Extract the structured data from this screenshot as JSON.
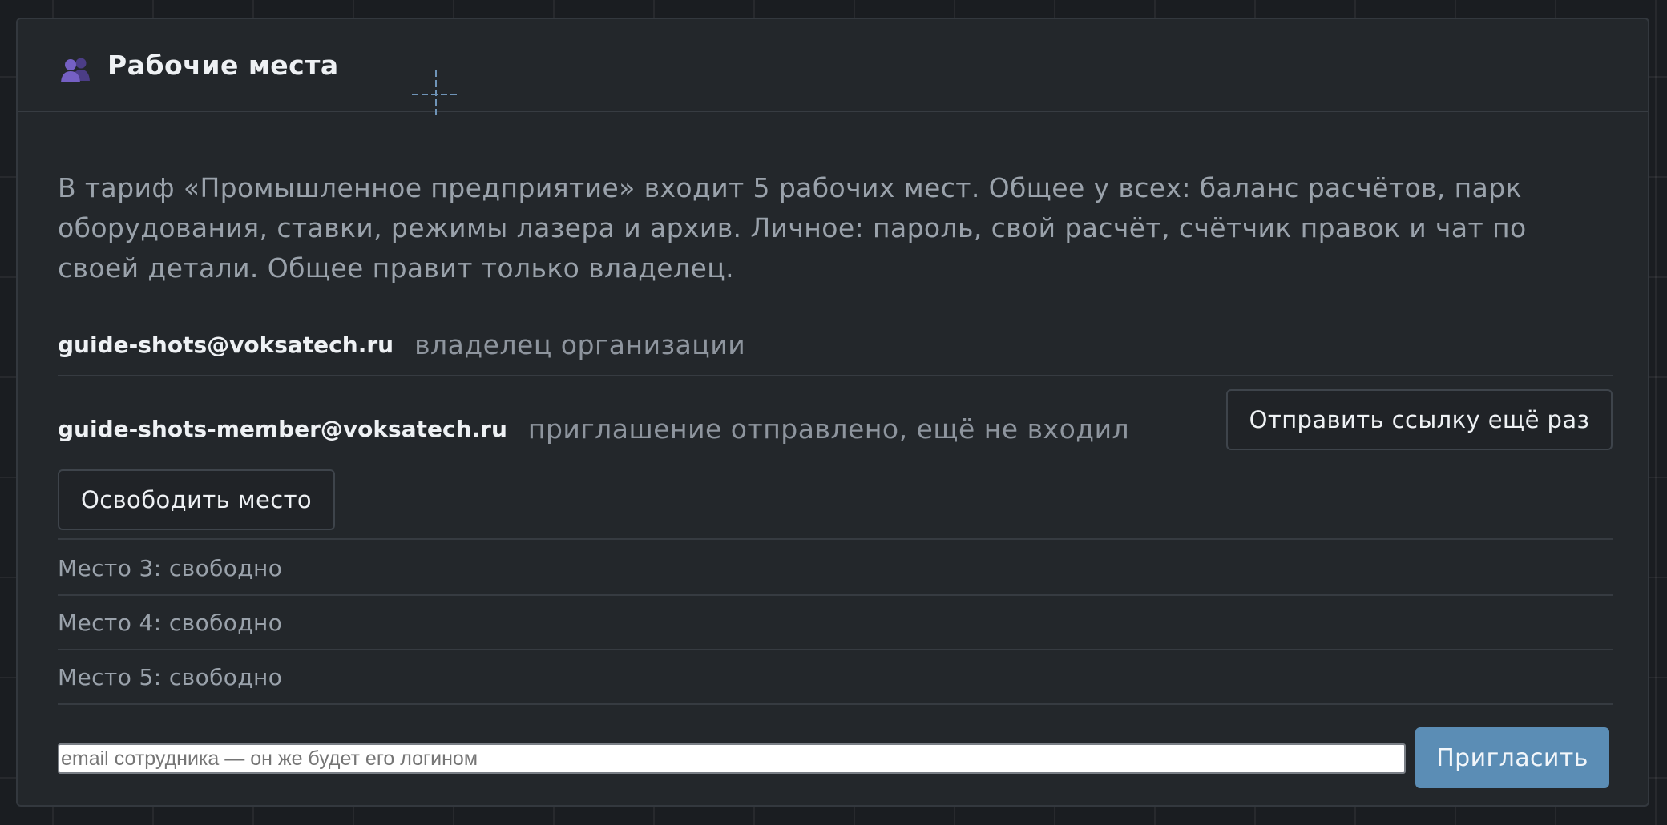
{
  "header": {
    "title": "Рабочие места",
    "icon": "users-icon"
  },
  "description": "В тариф «Промышленное предприятие» входит 5 рабочих мест. Общее у всех: баланс расчётов, парк оборудования, ставки, режимы лазера и архив. Личное: пароль, свой расчёт, счётчик правок и чат по своей детали. Общее правит только владелец.",
  "seats": {
    "owner": {
      "email": "guide-shots@voksatech.ru",
      "status": "владелец организации"
    },
    "member": {
      "email": "guide-shots-member@voksatech.ru",
      "status": "приглашение отправлено, ещё не входил",
      "resend_label": "Отправить ссылку ещё раз",
      "free_label": "Освободить место"
    },
    "free": [
      "Место 3: свободно",
      "Место 4: свободно",
      "Место 5: свободно"
    ]
  },
  "invite": {
    "placeholder": "email сотрудника — он же будет его логином",
    "value": "",
    "button_label": "Пригласить"
  },
  "colors": {
    "accent": "#5b8db5",
    "panel": "#23272b",
    "background": "#1a1d21",
    "icon_purple": "#6a55b0"
  }
}
